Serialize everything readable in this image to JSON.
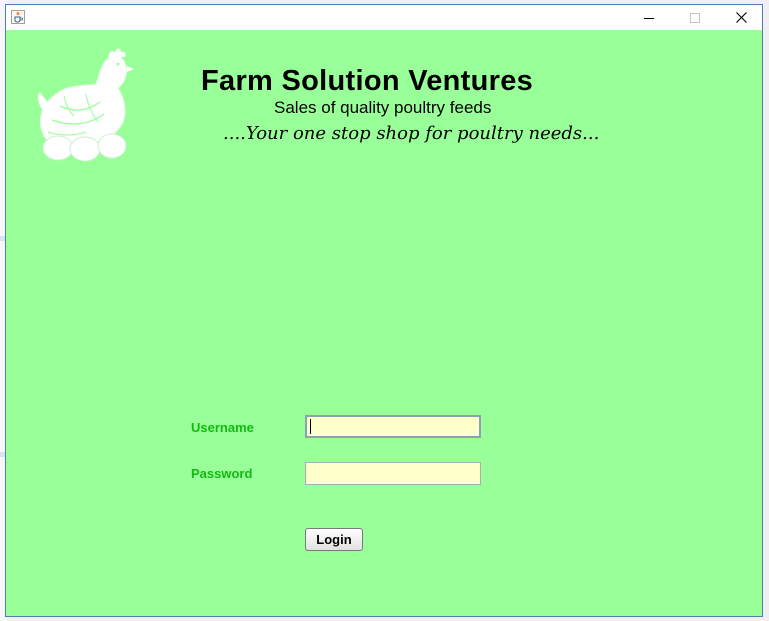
{
  "window": {
    "title": "",
    "controls": {
      "minimize": "minimize",
      "maximize": "maximize",
      "close": "close"
    }
  },
  "header": {
    "company_name": "Farm Solution Ventures",
    "subtitle": "Sales of quality poultry feeds",
    "tagline": "....Your one stop shop for poultry needs..."
  },
  "login_form": {
    "username_label": "Username",
    "username_value": "",
    "password_label": "Password",
    "password_value": "",
    "login_button": "Login"
  },
  "colors": {
    "background": "#99ff99",
    "label_green": "#11bb11",
    "field_background": "#ffffcc"
  },
  "icons": {
    "app": "java-cup-icon",
    "logo": "hen-with-eggs-logo"
  }
}
